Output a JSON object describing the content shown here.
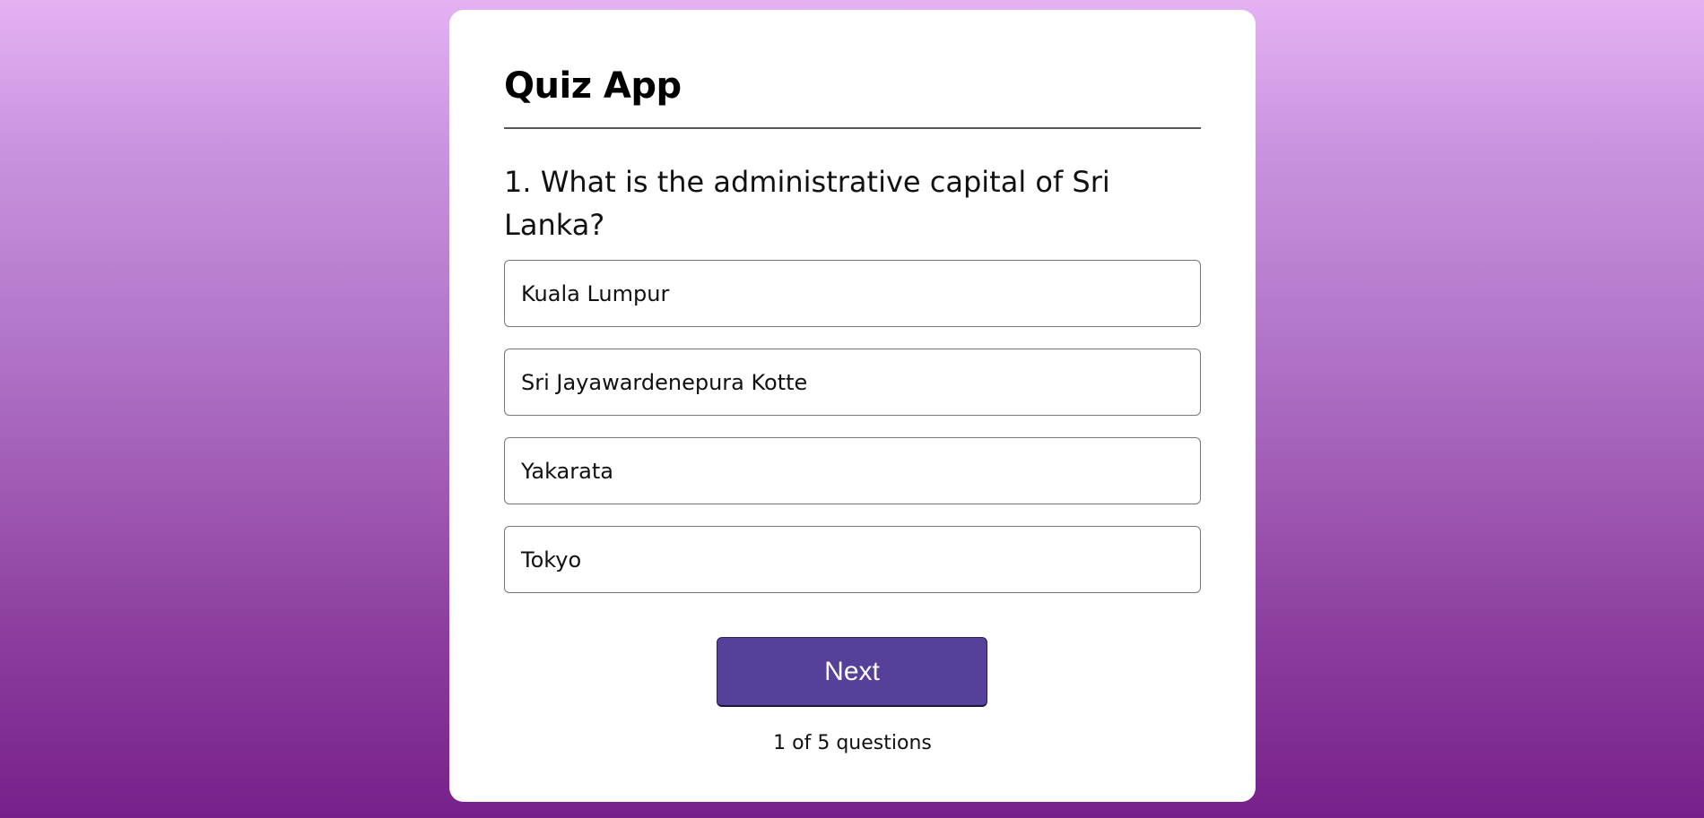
{
  "app": {
    "title": "Quiz App"
  },
  "question": {
    "text": "1. What is the administrative capital of Sri Lanka?"
  },
  "answers": [
    {
      "label": "Kuala Lumpur"
    },
    {
      "label": "Sri Jayawardenepura Kotte"
    },
    {
      "label": "Yakarata"
    },
    {
      "label": "Tokyo"
    }
  ],
  "controls": {
    "next_label": "Next"
  },
  "progress": {
    "text": "1 of 5 questions"
  },
  "colors": {
    "button_primary": "#55409a",
    "background_top": "#e4b2f3",
    "background_bottom": "#77208a"
  }
}
